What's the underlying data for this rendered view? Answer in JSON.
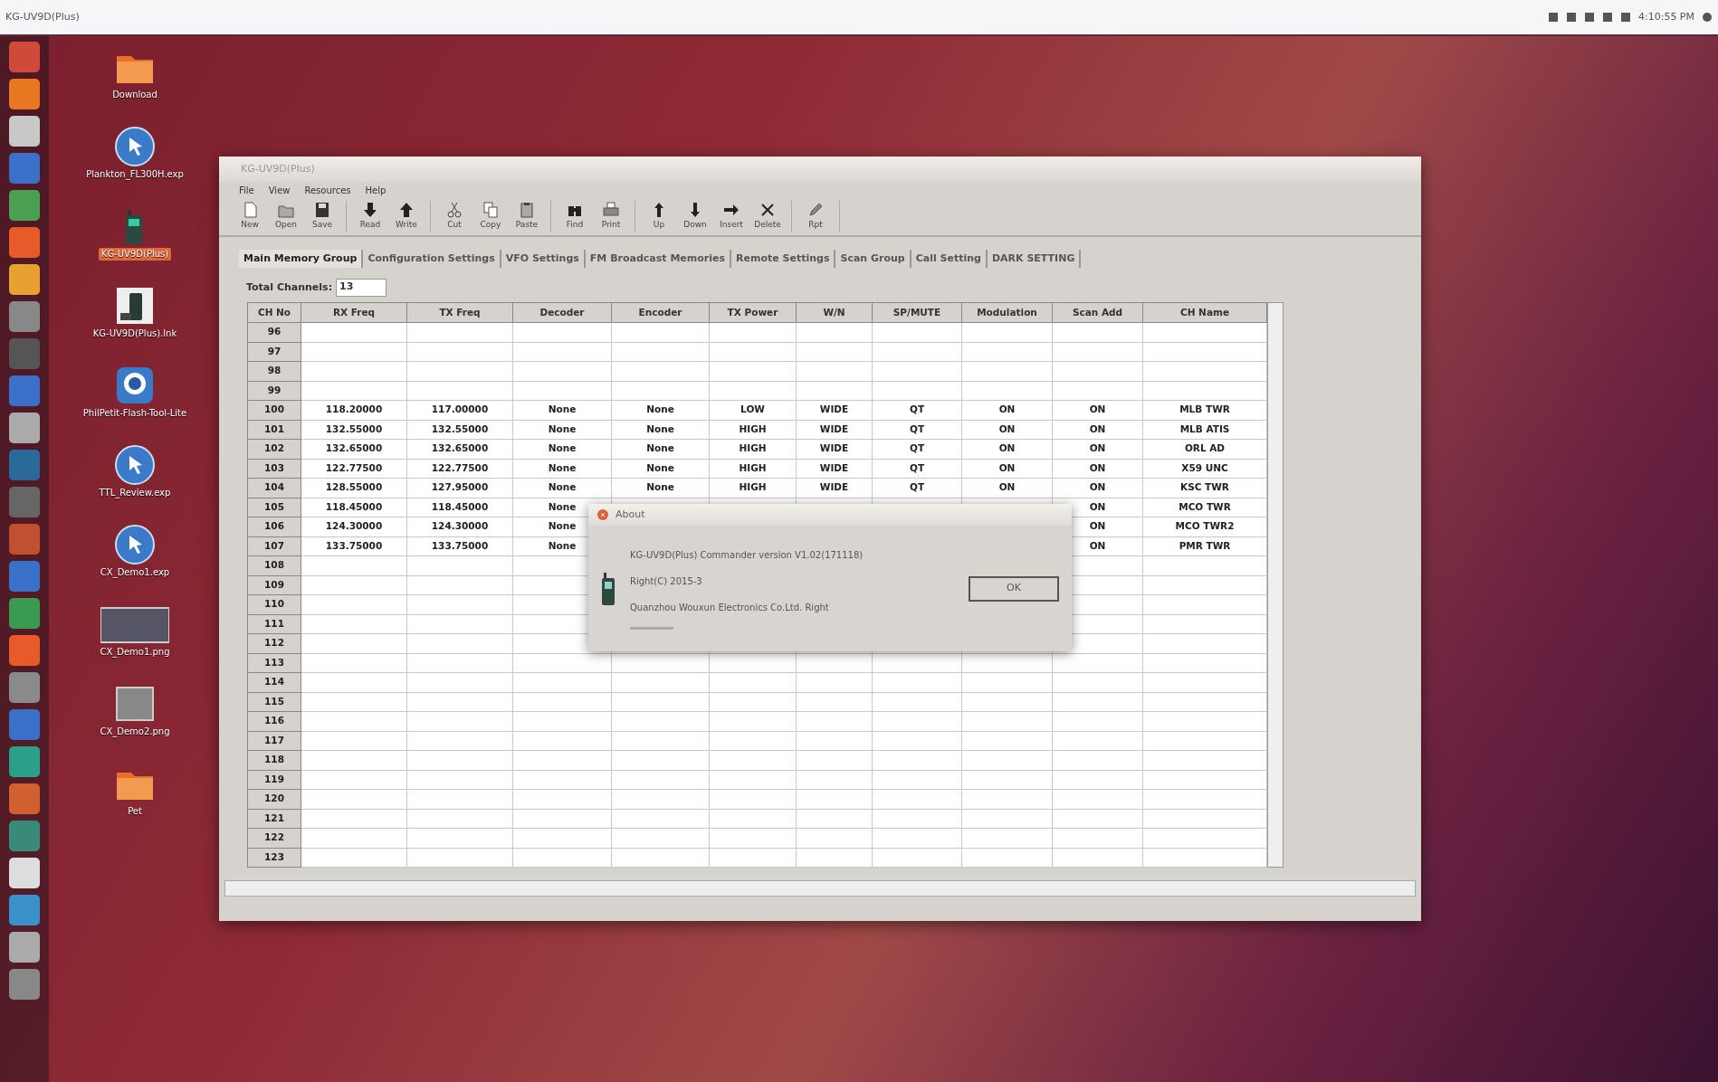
{
  "top_bar": {
    "title": "KG-UV9D(Plus)",
    "clock": "4:10:55 PM"
  },
  "desktop_icons": [
    {
      "label": "Download",
      "kind": "folder",
      "selected": false
    },
    {
      "label": "Plankton_FL300H.exp",
      "kind": "globe",
      "selected": false
    },
    {
      "label": "KG-UV9D(Plus)",
      "kind": "radio",
      "selected": true
    },
    {
      "label": "KG-UV9D(Plus).lnk",
      "kind": "radio-file",
      "selected": false
    },
    {
      "label": "PhilPetit-Flash-Tool-Lite",
      "kind": "app",
      "selected": false
    },
    {
      "label": "TTL_Review.exp",
      "kind": "globe",
      "selected": false
    },
    {
      "label": "CX_Demo1.exp",
      "kind": "globe",
      "selected": false
    },
    {
      "label": "CX_Demo1.png",
      "kind": "image",
      "selected": false
    },
    {
      "label": "CX_Demo2.png",
      "kind": "png",
      "selected": false
    },
    {
      "label": "Pet",
      "kind": "folder",
      "selected": false
    }
  ],
  "window": {
    "title": "KG-UV9D(Plus)",
    "menu": [
      "File",
      "View",
      "Resources",
      "Help"
    ],
    "toolbar": [
      [
        "New",
        "Open",
        "Save"
      ],
      [
        "Read",
        "Write"
      ],
      [
        "Cut",
        "Copy",
        "Paste"
      ],
      [
        "Find",
        "Print"
      ],
      [
        "Up",
        "Down",
        "Insert",
        "Delete"
      ],
      [
        "Rpt"
      ]
    ],
    "tabs": [
      {
        "label": "Main Memory Group",
        "selected": true
      },
      {
        "label": "Configuration Settings",
        "selected": false
      },
      {
        "label": "VFO Settings",
        "selected": false
      },
      {
        "label": "FM Broadcast Memories",
        "selected": false
      },
      {
        "label": "Remote Settings",
        "selected": false
      },
      {
        "label": "Scan Group",
        "selected": false
      },
      {
        "label": "Call Setting",
        "selected": false
      },
      {
        "label": "DARK SETTING",
        "selected": false
      }
    ],
    "total_channels": {
      "label": "Total Channels:",
      "value": "13"
    },
    "table": {
      "columns": [
        "CH No",
        "RX Freq",
        "TX Freq",
        "Decoder",
        "Encoder",
        "TX Power",
        "W/N",
        "SP/MUTE",
        "Modulation",
        "Scan Add",
        "CH Name"
      ],
      "rows": [
        {
          "ch_no": "96"
        },
        {
          "ch_no": "97"
        },
        {
          "ch_no": "98"
        },
        {
          "ch_no": "99"
        },
        {
          "ch_no": "100",
          "cells": [
            "118.20000",
            "117.00000",
            "None",
            "None",
            "LOW",
            "WIDE",
            "QT",
            "ON",
            "ON",
            "MLB TWR"
          ]
        },
        {
          "ch_no": "101",
          "cells": [
            "132.55000",
            "132.55000",
            "None",
            "None",
            "HIGH",
            "WIDE",
            "QT",
            "ON",
            "ON",
            "MLB ATIS"
          ]
        },
        {
          "ch_no": "102",
          "cells": [
            "132.65000",
            "132.65000",
            "None",
            "None",
            "HIGH",
            "WIDE",
            "QT",
            "ON",
            "ON",
            "ORL AD"
          ]
        },
        {
          "ch_no": "103",
          "cells": [
            "122.77500",
            "122.77500",
            "None",
            "None",
            "HIGH",
            "WIDE",
            "QT",
            "ON",
            "ON",
            "X59 UNC"
          ]
        },
        {
          "ch_no": "104",
          "cells": [
            "128.55000",
            "127.95000",
            "None",
            "None",
            "HIGH",
            "WIDE",
            "QT",
            "ON",
            "ON",
            "KSC TWR"
          ]
        },
        {
          "ch_no": "105",
          "cells": [
            "118.45000",
            "118.45000",
            "None",
            null,
            null,
            null,
            null,
            null,
            "ON",
            "MCO TWR"
          ]
        },
        {
          "ch_no": "106",
          "cells": [
            "124.30000",
            "124.30000",
            "None",
            null,
            null,
            null,
            null,
            null,
            "ON",
            "MCO TWR2"
          ]
        },
        {
          "ch_no": "107",
          "cells": [
            "133.75000",
            "133.75000",
            "None",
            null,
            null,
            null,
            null,
            null,
            "ON",
            "PMR TWR"
          ]
        },
        {
          "ch_no": "108"
        },
        {
          "ch_no": "109"
        },
        {
          "ch_no": "110"
        },
        {
          "ch_no": "111"
        },
        {
          "ch_no": "112"
        },
        {
          "ch_no": "113"
        },
        {
          "ch_no": "114"
        },
        {
          "ch_no": "115"
        },
        {
          "ch_no": "116"
        },
        {
          "ch_no": "117"
        },
        {
          "ch_no": "118"
        },
        {
          "ch_no": "119"
        },
        {
          "ch_no": "120"
        },
        {
          "ch_no": "121"
        },
        {
          "ch_no": "122"
        },
        {
          "ch_no": "123"
        }
      ]
    },
    "dialog": {
      "title": "About",
      "lines": [
        "KG-UV9D(Plus) Commander version V1.02(171118)",
        "Right(C) 2015-3",
        "Quanzhou Wouxun Electronics Co.Ltd. Right"
      ],
      "button": "OK"
    }
  }
}
